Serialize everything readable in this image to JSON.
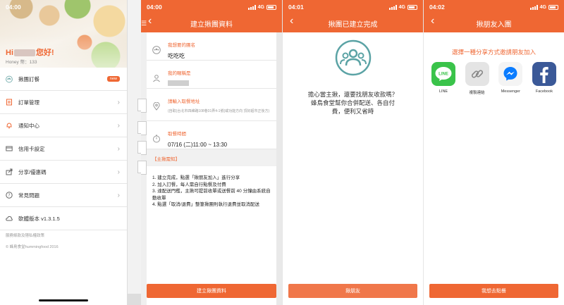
{
  "panel1": {
    "time": "04:00",
    "greeting_prefix": "Hi",
    "greeting_suffix": "您好!",
    "honey": "Honey 幣：133",
    "menu": [
      {
        "label": "揪團訂餐",
        "icon": "group-icon",
        "badge": "new"
      },
      {
        "label": "訂單管理",
        "icon": "receipt-icon"
      },
      {
        "label": "通知中心",
        "icon": "bell-icon"
      },
      {
        "label": "信用卡設定",
        "icon": "credit-card-icon"
      },
      {
        "label": "分享/優惠碼",
        "icon": "share-icon"
      },
      {
        "label": "常見問題",
        "icon": "help-icon"
      },
      {
        "label": "軟體版本 v1.3.1.5",
        "icon": "cloud-icon"
      }
    ],
    "footer_policy": "服務條款及隱私權政策",
    "footer_copyright": "© 蜂鳥食堂hummingfood 2016"
  },
  "panel2": {
    "time": "04:00",
    "network": "4G",
    "title": "建立揪團資料",
    "fields": {
      "group_name_label": "我想要的團名",
      "group_name_value": "吃吃吃",
      "nickname_label": "我的暱稱是",
      "address_label": "請輸入取餐地址",
      "address_hint": "(自取)台北市四維路108巷31弄4-1號(或功能方向 頂好超市正後方)",
      "time_label": "取餐時間",
      "time_value": "07/16 (二)11:00 ~ 13:30"
    },
    "notice_title": "【主揪需知】",
    "notice_items": [
      "1. 建立完成，點選「揪朋友加入」進行分享",
      "2. 加入訂餐，每人需自行點餐及付費",
      "3. 達配送門檻，主揪可提前收單或送餐前 40 分鐘由系統自動收單",
      "4. 點選「取消/退費」整筆揪團則執行退費並取消配送"
    ],
    "button": "建立揪團資料"
  },
  "panel3": {
    "time": "04:01",
    "network": "4G",
    "title": "揪團已建立完成",
    "line1": "擔心當主揪，還要找朋友收款嗎？",
    "line2": "蜂鳥食堂幫你合併配送、各自付",
    "line3": "費，便利又省時",
    "button": "揪朋友"
  },
  "panel4": {
    "time": "04:02",
    "network": "4G",
    "title": "揪朋友入團",
    "prompt": "選擇一種分享方式邀請朋友加入",
    "shares": [
      {
        "label": "LINE",
        "icon": "line-icon",
        "color": "#3ac34a"
      },
      {
        "label": "複製連結",
        "icon": "link-icon",
        "color": "#dedede"
      },
      {
        "label": "Messenger",
        "icon": "messenger-icon",
        "color": "#0a7cff"
      },
      {
        "label": "Facebook",
        "icon": "facebook-icon",
        "color": "#3b5998"
      }
    ],
    "button": "我想去點餐"
  },
  "colors": {
    "accent": "#ef6733"
  }
}
